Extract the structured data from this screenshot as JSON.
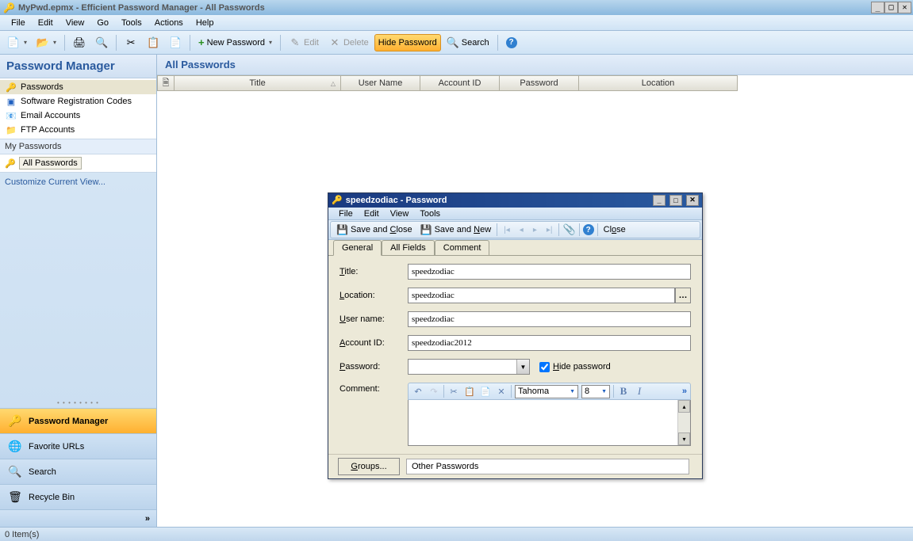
{
  "window": {
    "title": "MyPwd.epmx - Efficient Password Manager - All Passwords"
  },
  "menu": {
    "file": "File",
    "edit": "Edit",
    "view": "View",
    "go": "Go",
    "tools": "Tools",
    "actions": "Actions",
    "help": "Help"
  },
  "toolbar": {
    "new_password": "New Password",
    "edit": "Edit",
    "delete": "Delete",
    "hide_password": "Hide Password",
    "search": "Search"
  },
  "sidebar": {
    "header": "Password Manager",
    "tree": {
      "passwords": "Passwords",
      "software_reg": "Software Registration Codes",
      "email": "Email Accounts",
      "ftp": "FTP Accounts"
    },
    "my_passwords_label": "My Passwords",
    "all_passwords": "All Passwords",
    "customize": "Customize Current View...",
    "nav": {
      "password_manager": "Password Manager",
      "favorite_urls": "Favorite URLs",
      "search": "Search",
      "recycle_bin": "Recycle Bin"
    }
  },
  "content": {
    "header": "All Passwords",
    "columns": {
      "title": "Title",
      "user_name": "User Name",
      "account_id": "Account ID",
      "password": "Password",
      "location": "Location"
    }
  },
  "statusbar": {
    "items": "0 Item(s)"
  },
  "dialog": {
    "title": "speedzodiac - Password",
    "menu": {
      "file": "File",
      "edit": "Edit",
      "view": "View",
      "tools": "Tools"
    },
    "toolbar": {
      "save_close": "Save and Close",
      "save_close_u": "C",
      "save_new": "Save and New",
      "save_new_u": "N",
      "close": "Close",
      "close_u": "o"
    },
    "tabs": {
      "general": "General",
      "all_fields": "All Fields",
      "comment": "Comment"
    },
    "form": {
      "title_label": "Title:",
      "title_u": "T",
      "title_value": "speedzodiac",
      "location_label": "Location:",
      "location_u": "L",
      "location_value": "speedzodiac",
      "username_label": "User name:",
      "username_u": "U",
      "username_value": "speedzodiac",
      "account_label": "Account ID:",
      "account_u": "A",
      "account_value": "speedzodiac2012",
      "password_label": "Password:",
      "password_u": "P",
      "password_value": "",
      "hide_password": "Hide password",
      "hide_u": "H",
      "comment_label": "Comment:",
      "comment_u": "m",
      "font": "Tahoma",
      "font_size": "8"
    },
    "footer": {
      "groups": "Groups...",
      "groups_u": "G",
      "other": "Other Passwords"
    }
  }
}
